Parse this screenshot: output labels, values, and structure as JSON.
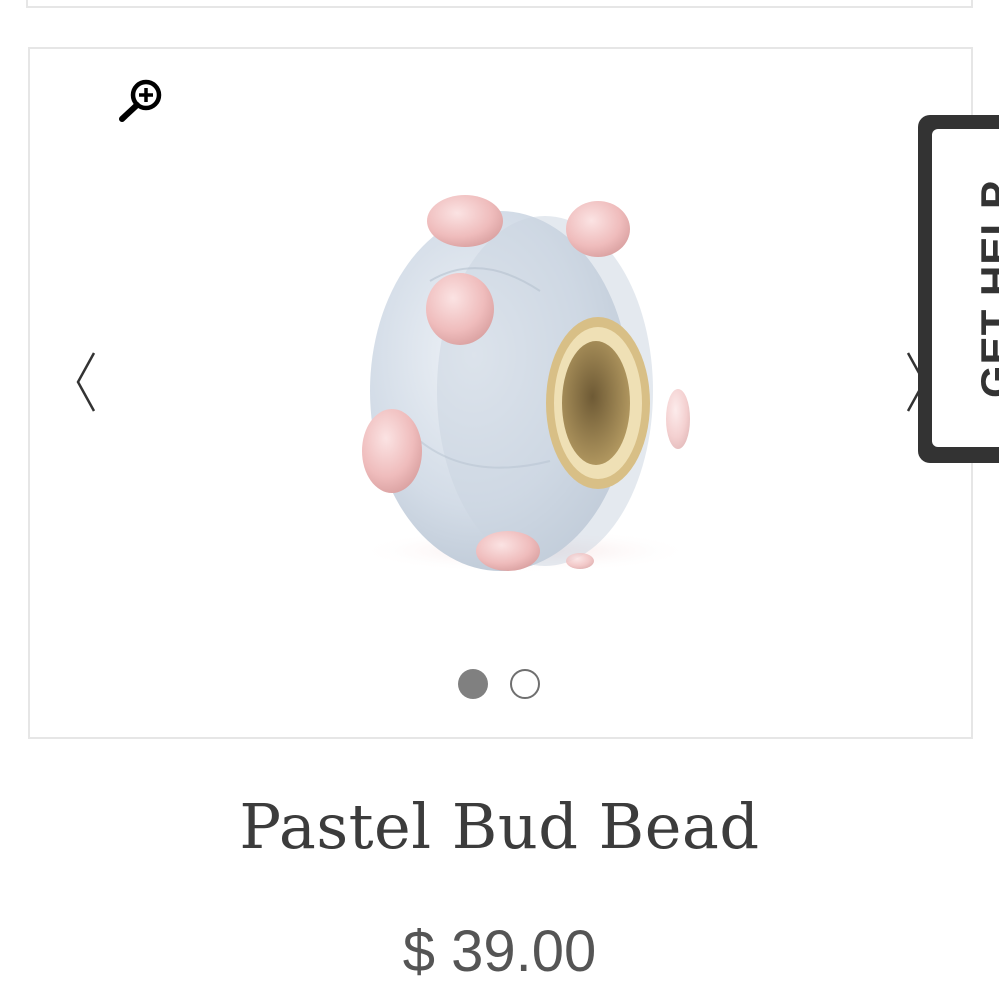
{
  "product": {
    "title": "Pastel Bud Bead",
    "price": "$ 39.00"
  },
  "gallery": {
    "zoom_icon": "zoom-in-icon",
    "prev_icon": "chevron-left-icon",
    "next_icon": "chevron-right-icon",
    "slide_count": 2,
    "active_slide": 1
  },
  "help_tab": {
    "label": "GET HELP"
  },
  "colors": {
    "title_text": "#3c3c3c",
    "price_text": "#555555",
    "help_tab_bg": "#333333",
    "dot_active": "#808080",
    "border": "#e6e6e6"
  }
}
